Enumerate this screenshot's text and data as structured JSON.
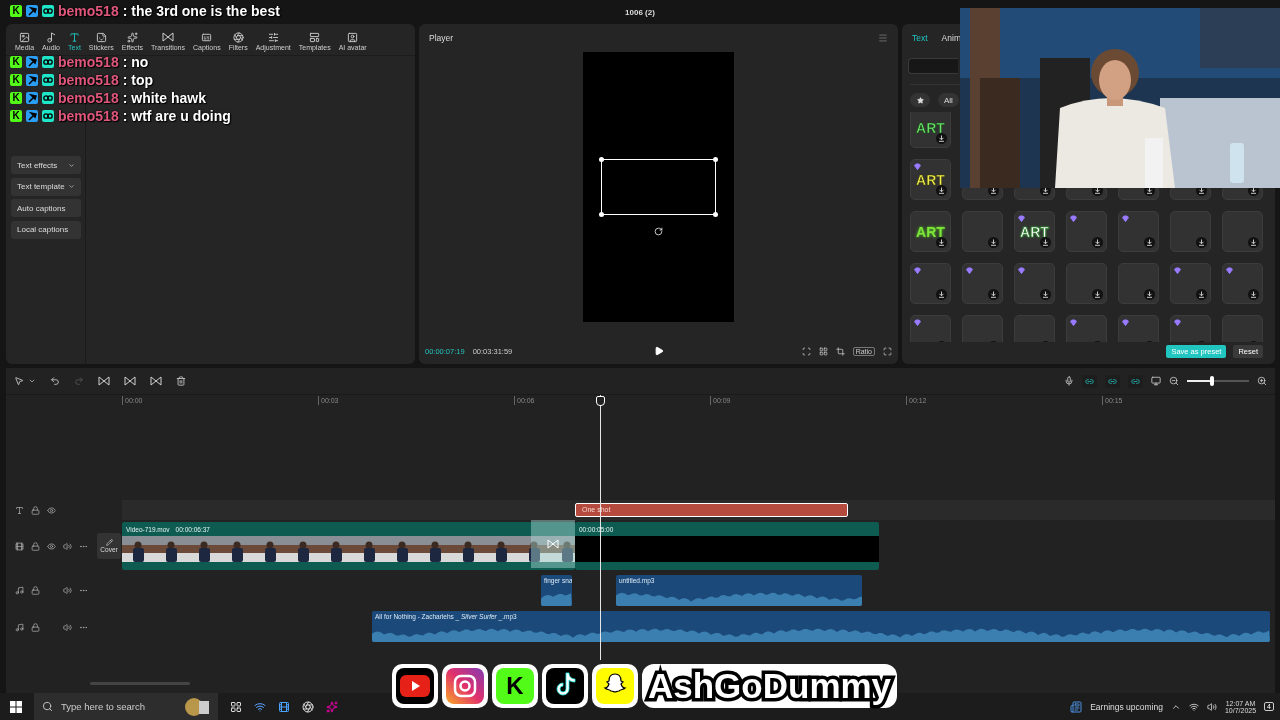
{
  "window": {
    "title": "1006 (2)"
  },
  "toolbar": [
    {
      "label": "Media",
      "selected": false
    },
    {
      "label": "Audio",
      "selected": false
    },
    {
      "label": "Text",
      "selected": true
    },
    {
      "label": "Stickers",
      "selected": false
    },
    {
      "label": "Effects",
      "selected": false
    },
    {
      "label": "Transitions",
      "selected": false
    },
    {
      "label": "Captions",
      "selected": false
    },
    {
      "label": "Filters",
      "selected": false
    },
    {
      "label": "Adjustment",
      "selected": false
    },
    {
      "label": "Templates",
      "selected": false
    },
    {
      "label": "AI avatar",
      "selected": false
    }
  ],
  "sidebar": [
    {
      "label": "Text effects",
      "expandable": true
    },
    {
      "label": "Text template",
      "expandable": true
    },
    {
      "label": "Auto captions",
      "expandable": false
    },
    {
      "label": "Local captions",
      "expandable": false
    }
  ],
  "player": {
    "title": "Player",
    "current_time": "00:00:07:19",
    "duration": "00:03:31:59",
    "ratio": "Ratio"
  },
  "inspector": {
    "tabs": [
      {
        "label": "Text",
        "selected": true
      },
      {
        "label": "Anim",
        "selected": false
      }
    ],
    "filter": "All",
    "tiles": [
      [
        {
          "kind": "art",
          "art": "ART",
          "premium": false
        }
      ],
      [
        {
          "kind": "art",
          "art": "ART",
          "premium": true
        },
        {
          "kind": "covered"
        },
        {
          "kind": "covered"
        },
        {
          "kind": "covered"
        },
        {
          "kind": "covered"
        },
        {
          "kind": "covered"
        },
        {
          "kind": "covered"
        }
      ],
      [
        {
          "kind": "art",
          "art": "ART",
          "premium": false
        },
        {
          "kind": "plain",
          "premium": false
        },
        {
          "kind": "art",
          "art": "ART",
          "premium": true
        },
        {
          "kind": "plain",
          "premium": true
        },
        {
          "kind": "plain",
          "premium": true
        },
        {
          "kind": "plain",
          "premium": false
        },
        {
          "kind": "plain",
          "premium": false
        }
      ],
      [
        {
          "kind": "plain",
          "premium": true
        },
        {
          "kind": "plain",
          "premium": true
        },
        {
          "kind": "plain",
          "premium": true
        },
        {
          "kind": "plain",
          "premium": false
        },
        {
          "kind": "plain",
          "premium": false
        },
        {
          "kind": "plain",
          "premium": true
        },
        {
          "kind": "plain",
          "premium": true
        }
      ],
      [
        {
          "kind": "plain",
          "premium": true
        },
        {
          "kind": "plain",
          "premium": false
        },
        {
          "kind": "plain",
          "premium": false
        },
        {
          "kind": "plain",
          "premium": true
        },
        {
          "kind": "plain",
          "premium": true
        },
        {
          "kind": "plain",
          "premium": true
        },
        {
          "kind": "plain",
          "premium": false
        }
      ]
    ],
    "save": "Save as preset",
    "reset": "Reset"
  },
  "timeline": {
    "ruler": [
      "00:00",
      "00:03",
      "00:06",
      "00:09",
      "00:12",
      "00:15"
    ],
    "zoom": {
      "level": 0.4
    },
    "tracks": [
      {
        "kind": "text",
        "clips": [
          {
            "kind": "text",
            "label": "One shot",
            "selected": true
          }
        ]
      },
      {
        "kind": "video",
        "cover": "Cover",
        "clips": [
          {
            "kind": "footage",
            "name": "Video-719.mov",
            "duration": "00:00:06:37"
          },
          {
            "kind": "blank",
            "duration": "00:00:05:00"
          }
        ]
      },
      {
        "kind": "audio",
        "clips": [
          {
            "kind": "audio",
            "name": "finger sna"
          },
          {
            "kind": "audio",
            "name": "untitled.mp3"
          }
        ]
      },
      {
        "kind": "audio",
        "clips": [
          {
            "kind": "audio",
            "name": "All for Nothing - Zacharlehs _ *Silver Surfer* _.mp3"
          }
        ]
      }
    ]
  },
  "chat": [
    {
      "glyph": "K",
      "user": "bemo518",
      "message": ": the 3rd one is the best"
    },
    {
      "glyph": "K",
      "user": "bemo518",
      "message": ": no"
    },
    {
      "glyph": "K",
      "user": "bemo518",
      "message": ": top"
    },
    {
      "glyph": "K",
      "user": "bemo518",
      "message": ": white hawk"
    },
    {
      "glyph": "K",
      "user": "bemo518",
      "message": ": wtf are u doing"
    }
  ],
  "banner": {
    "icons": [
      {
        "kind": "youtube"
      },
      {
        "kind": "instagram"
      },
      {
        "kind": "kick",
        "glyph": "K"
      },
      {
        "kind": "tiktok"
      },
      {
        "kind": "snapchat"
      }
    ],
    "brand": "AshGoDummy"
  },
  "taskbar": {
    "placeholder": "Type here to search",
    "news": "Earnings upcoming",
    "time": "12:07 AM",
    "date": "10/7/2025",
    "notifications": "4"
  }
}
